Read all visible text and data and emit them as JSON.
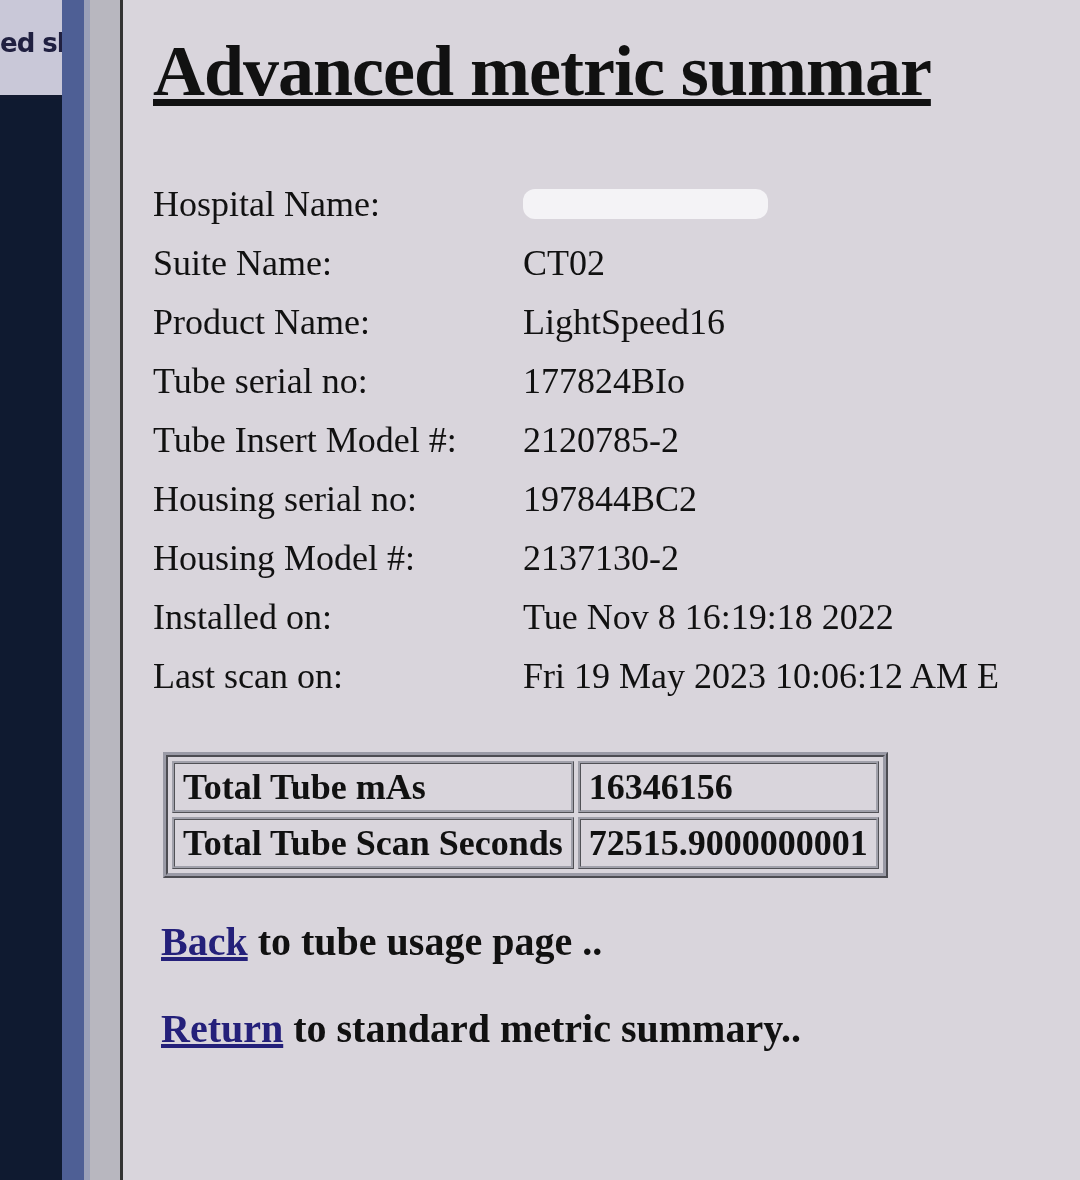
{
  "side_window": {
    "title": "ed sl"
  },
  "page": {
    "title": "Advanced metric summar",
    "fields": [
      {
        "label": "Hospital Name:",
        "redacted": true
      },
      {
        "label": "Suite Name:",
        "value": "CT02",
        "redacted": false
      },
      {
        "label": "Product Name:",
        "value": "LightSpeed16",
        "redacted": false
      },
      {
        "label": "Tube serial no:",
        "value": "177824BIo",
        "redacted": false
      },
      {
        "label": "Tube Insert Model #:",
        "value": "2120785-2",
        "redacted": false
      },
      {
        "label": "Housing serial no:",
        "value": "197844BC2",
        "redacted": false
      },
      {
        "label": "Housing Model #:",
        "value": "2137130-2",
        "redacted": false
      },
      {
        "label": "Installed on:",
        "value": "Tue Nov 8 16:19:18 2022",
        "redacted": false
      },
      {
        "label": "Last scan on:",
        "value": "Fri 19 May 2023 10:06:12 AM E",
        "redacted": false
      }
    ],
    "table": {
      "rows": [
        {
          "label": "Total Tube mAs",
          "value": "16346156"
        },
        {
          "label": "Total Tube Scan Seconds",
          "value": "72515.9000000001"
        }
      ]
    },
    "links": [
      {
        "link": "Back",
        "text": "to tube usage page .."
      },
      {
        "link": "Return",
        "text": "to standard metric summary.."
      }
    ]
  }
}
